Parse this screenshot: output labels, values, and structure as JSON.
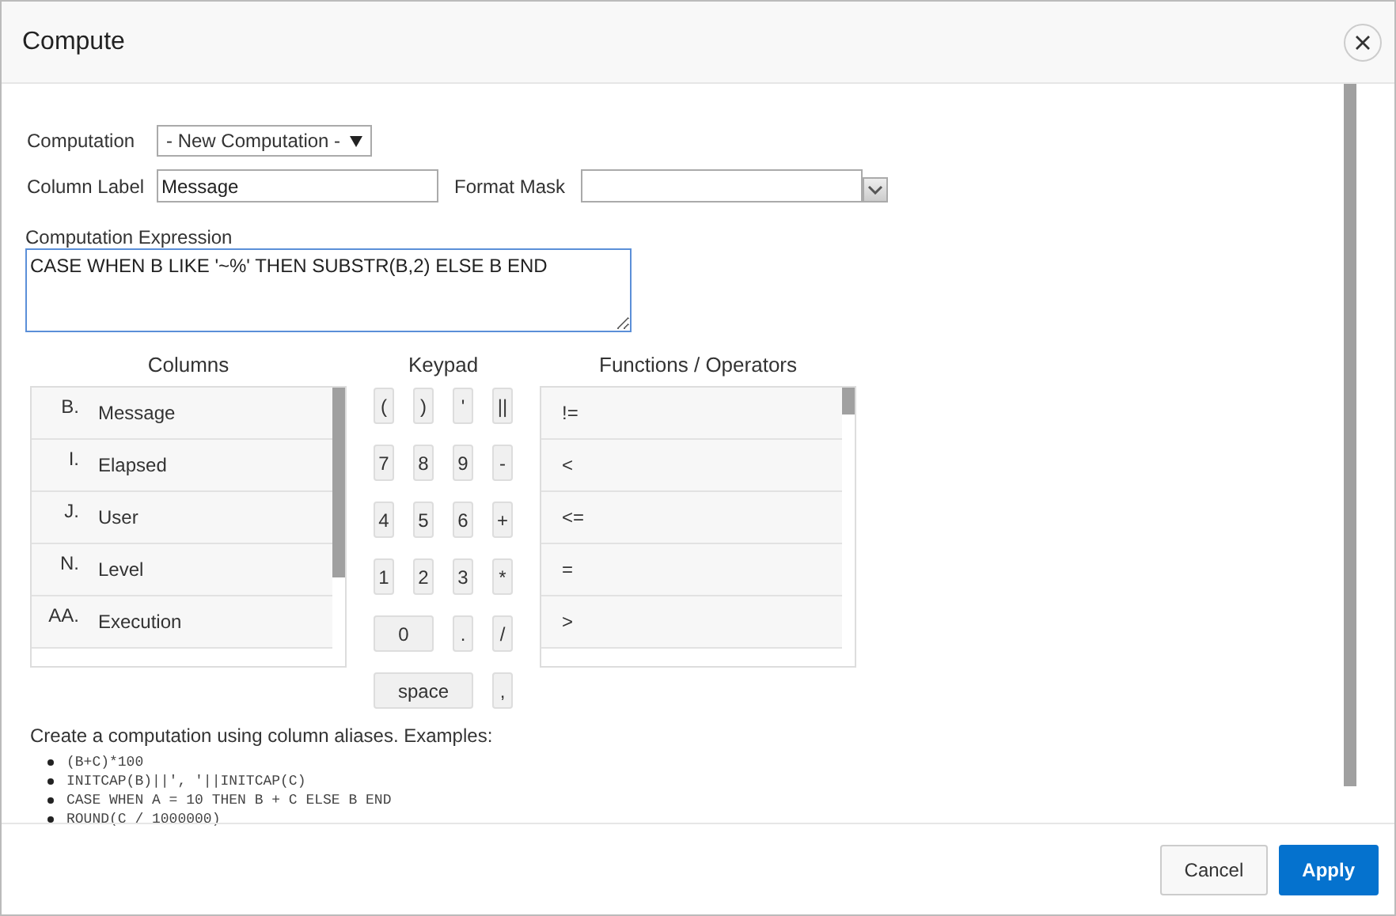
{
  "dialog": {
    "title": "Compute"
  },
  "form": {
    "computation": {
      "label": "Computation",
      "value": "- New Computation -"
    },
    "column_label": {
      "label": "Column Label",
      "value": "Message"
    },
    "format_mask": {
      "label": "Format Mask"
    },
    "expression": {
      "label": "Computation Expression",
      "value": "CASE WHEN B LIKE '~%' THEN SUBSTR(B,2) ELSE B END"
    }
  },
  "columns": {
    "heading": "Columns",
    "items": [
      {
        "alias": "B.",
        "name": "Message"
      },
      {
        "alias": "I.",
        "name": "Elapsed"
      },
      {
        "alias": "J.",
        "name": "User"
      },
      {
        "alias": "N.",
        "name": "Level"
      },
      {
        "alias": "AA.",
        "name": "Execution"
      }
    ]
  },
  "keypad": {
    "heading": "Keypad",
    "keys": [
      {
        "key": "(",
        "kind": "single"
      },
      {
        "key": ")",
        "kind": "single"
      },
      {
        "key": "'",
        "kind": "single"
      },
      {
        "key": "||",
        "kind": "single"
      },
      {
        "key": "7",
        "kind": "single"
      },
      {
        "key": "8",
        "kind": "single"
      },
      {
        "key": "9",
        "kind": "single"
      },
      {
        "key": "-",
        "kind": "single"
      },
      {
        "key": "4",
        "kind": "single"
      },
      {
        "key": "5",
        "kind": "single"
      },
      {
        "key": "6",
        "kind": "single"
      },
      {
        "key": "+",
        "kind": "single"
      },
      {
        "key": "1",
        "kind": "single"
      },
      {
        "key": "2",
        "kind": "single"
      },
      {
        "key": "3",
        "kind": "single"
      },
      {
        "key": "*",
        "kind": "single"
      },
      {
        "key": "0",
        "kind": "double"
      },
      {
        "key": ".",
        "kind": "single"
      },
      {
        "key": "/",
        "kind": "single"
      },
      {
        "key": "space",
        "kind": "triple"
      },
      {
        "key": ",",
        "kind": "single"
      }
    ]
  },
  "functions": {
    "heading": "Functions / Operators",
    "items": [
      "!=",
      "<",
      "<=",
      "=",
      ">"
    ]
  },
  "help": {
    "text": "Create a computation using column aliases. Examples:",
    "examples": [
      "(B+C)*100",
      "INITCAP(B)||', '||INITCAP(C)",
      "CASE WHEN A = 10 THEN B + C ELSE B END",
      "ROUND(C / 1000000)"
    ]
  },
  "buttons": [
    {
      "label": "Cancel",
      "kind": "secondary"
    },
    {
      "label": "Apply",
      "kind": "primary"
    }
  ]
}
